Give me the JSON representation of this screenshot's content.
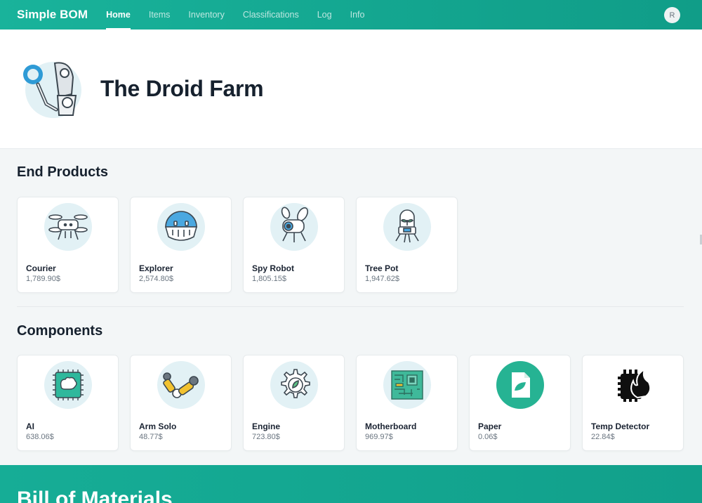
{
  "app": {
    "brand": "Simple BOM",
    "avatar_initial": "R"
  },
  "nav": [
    {
      "label": "Home",
      "active": true
    },
    {
      "label": "Items",
      "active": false
    },
    {
      "label": "Inventory",
      "active": false
    },
    {
      "label": "Classifications",
      "active": false
    },
    {
      "label": "Log",
      "active": false
    },
    {
      "label": "Info",
      "active": false
    }
  ],
  "hero": {
    "title": "The Droid Farm",
    "icon": "robot-illustration"
  },
  "end_products": {
    "title": "End Products",
    "items": [
      {
        "name": "Courier",
        "price": "1,789.90$",
        "icon": "drone-robot-icon"
      },
      {
        "name": "Explorer",
        "price": "2,574.80$",
        "icon": "dome-robot-icon"
      },
      {
        "name": "Spy Robot",
        "price": "1,805.15$",
        "icon": "spy-robot-icon"
      },
      {
        "name": "Tree Pot",
        "price": "1,947.62$",
        "icon": "tree-pot-robot-icon"
      }
    ]
  },
  "components": {
    "title": "Components",
    "items": [
      {
        "name": "AI",
        "price": "638.06$",
        "icon": "brain-chip-icon"
      },
      {
        "name": "Arm Solo",
        "price": "48.77$",
        "icon": "robot-arm-icon"
      },
      {
        "name": "Engine",
        "price": "723.80$",
        "icon": "gear-leaf-icon"
      },
      {
        "name": "Motherboard",
        "price": "969.97$",
        "icon": "circuit-board-icon"
      },
      {
        "name": "Paper",
        "price": "0.06$",
        "icon": "paper-leaf-icon"
      },
      {
        "name": "Temp Detector",
        "price": "22.84$",
        "icon": "flame-chip-icon"
      }
    ]
  },
  "bom": {
    "title": "Bill of Materials"
  },
  "colors": {
    "accent": "#13a58f",
    "card_bg": "#ffffff",
    "page_bg": "#f3f6f7",
    "thumb_bg": "#e2f1f5"
  }
}
